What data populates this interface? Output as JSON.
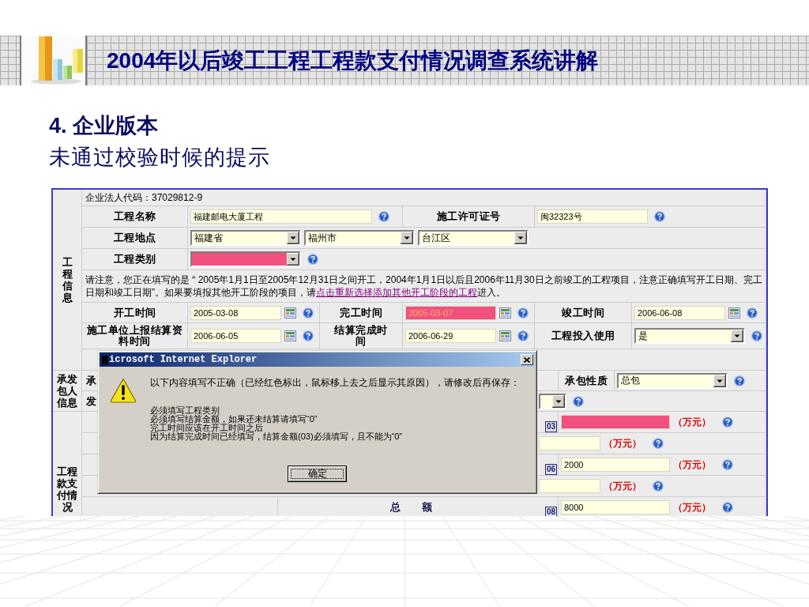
{
  "slide": {
    "title": "2004年以后竣工工程工程款支付情况调查系统讲解",
    "heading": "4. 企业版本",
    "subheading": "未通过校验时候的提示"
  },
  "form": {
    "org_code": "企业法人代码：37029812-9",
    "project": {
      "label": "工程信息",
      "rows": [
        {
          "kind": "pair",
          "items": [
            {
              "label": "工程名称",
              "field": {
                "kind": "text",
                "value": "福建邮电大厦工程",
                "invalid": false,
                "help": true
              }
            },
            {
              "label": "施工许可证号",
              "field": {
                "kind": "text",
                "value": "闽32323号",
                "invalid": false,
                "help": true
              }
            }
          ]
        },
        {
          "kind": "fields",
          "label": "工程地点",
          "fields": [
            {
              "kind": "select",
              "value": "福建省",
              "invalid": false,
              "help": false
            },
            {
              "kind": "select",
              "value": "福州市",
              "invalid": false,
              "help": false
            },
            {
              "kind": "select",
              "value": "台江区",
              "invalid": false,
              "help": false
            }
          ]
        },
        {
          "kind": "fields",
          "label": "工程类别",
          "fields": [
            {
              "kind": "select",
              "invalid": true,
              "help": true
            }
          ]
        },
        {
          "kind": "notice",
          "text": "请注意，您正在填写的是 “ 2005年1月1日至2005年12月31日之间开工，2004年1月1日以后且2006年11月30日之前竣工的工程项目，注意正确填写开工日期、完工日期和竣工日期”。如果要填报其他开工阶段的项目，请",
          "link": "点击重新选择添加其他开工阶段的工程",
          "after": "进入。"
        },
        {
          "kind": "triple",
          "items": [
            {
              "label": "开工时间",
              "field": {
                "kind": "date",
                "value": "2005-03-08",
                "invalid": false,
                "help": true
              }
            },
            {
              "label": "完工时间",
              "field": {
                "kind": "date",
                "value": "2005-03-07",
                "invalid": true,
                "help": true
              }
            },
            {
              "label": "竣工时间",
              "field": {
                "kind": "date",
                "value": "2006-06-08",
                "invalid": false,
                "help": true
              }
            }
          ]
        },
        {
          "kind": "triple",
          "items": [
            {
              "label": "施工单位上报结算资料时间",
              "field": {
                "kind": "date",
                "value": "2006-06-05",
                "invalid": false,
                "help": true
              }
            },
            {
              "label": "结算完成时间",
              "field": {
                "kind": "date",
                "value": "2006-06-29",
                "invalid": false,
                "help": true
              }
            },
            {
              "label": "工程投入使用",
              "field": {
                "kind": "select",
                "value": "是",
                "invalid": false,
                "help": true
              }
            }
          ]
        },
        {
          "kind": "blank"
        }
      ]
    },
    "contractor": {
      "label": "承发包人信息",
      "rows": [
        {
          "kind": "pair",
          "label": "承",
          "field_label": "承包性质",
          "field": {
            "kind": "select",
            "value": "总包",
            "invalid": false,
            "help": true
          }
        },
        {
          "kind": "field",
          "label": "发",
          "field": {
            "kind": "select",
            "invalid": false,
            "help": true
          }
        }
      ]
    },
    "payment": {
      "label": "工程款支付情况",
      "rows": [
        {
          "kind": "coded",
          "code": "03",
          "field": {
            "kind": "text",
            "invalid": true,
            "help": true
          },
          "unit": "（万元）"
        },
        {
          "kind": "plain",
          "field": {
            "kind": "text",
            "invalid": false,
            "help": true
          },
          "unit": "（万元）"
        },
        {
          "kind": "coded",
          "code": "06",
          "field": {
            "kind": "text",
            "value": "2000",
            "invalid": false,
            "help": true
          },
          "unit": "（万元）"
        },
        {
          "kind": "plain",
          "field": {
            "kind": "text",
            "invalid": false,
            "help": true
          },
          "unit": "（万元）"
        },
        {
          "kind": "coded",
          "label": "总　　额",
          "code": "08",
          "field": {
            "kind": "text",
            "value": "8000",
            "invalid": false,
            "help": true
          },
          "unit": "（万元）"
        }
      ]
    }
  },
  "dialog": {
    "title": "icrosoft Internet Explorer",
    "message": "以下内容填写不正确（已经红色标出，鼠标移上去之后显示其原因），请修改后再保存：",
    "errors": [
      "必须填写工程类别",
      "必须填写结算金额，如果还未结算请填写“0”",
      "完工时间应该在开工时间之后",
      "因为结算完成时间已经填写，结算金额(03)必须填写，且不能为“0”"
    ],
    "button": "确定"
  }
}
